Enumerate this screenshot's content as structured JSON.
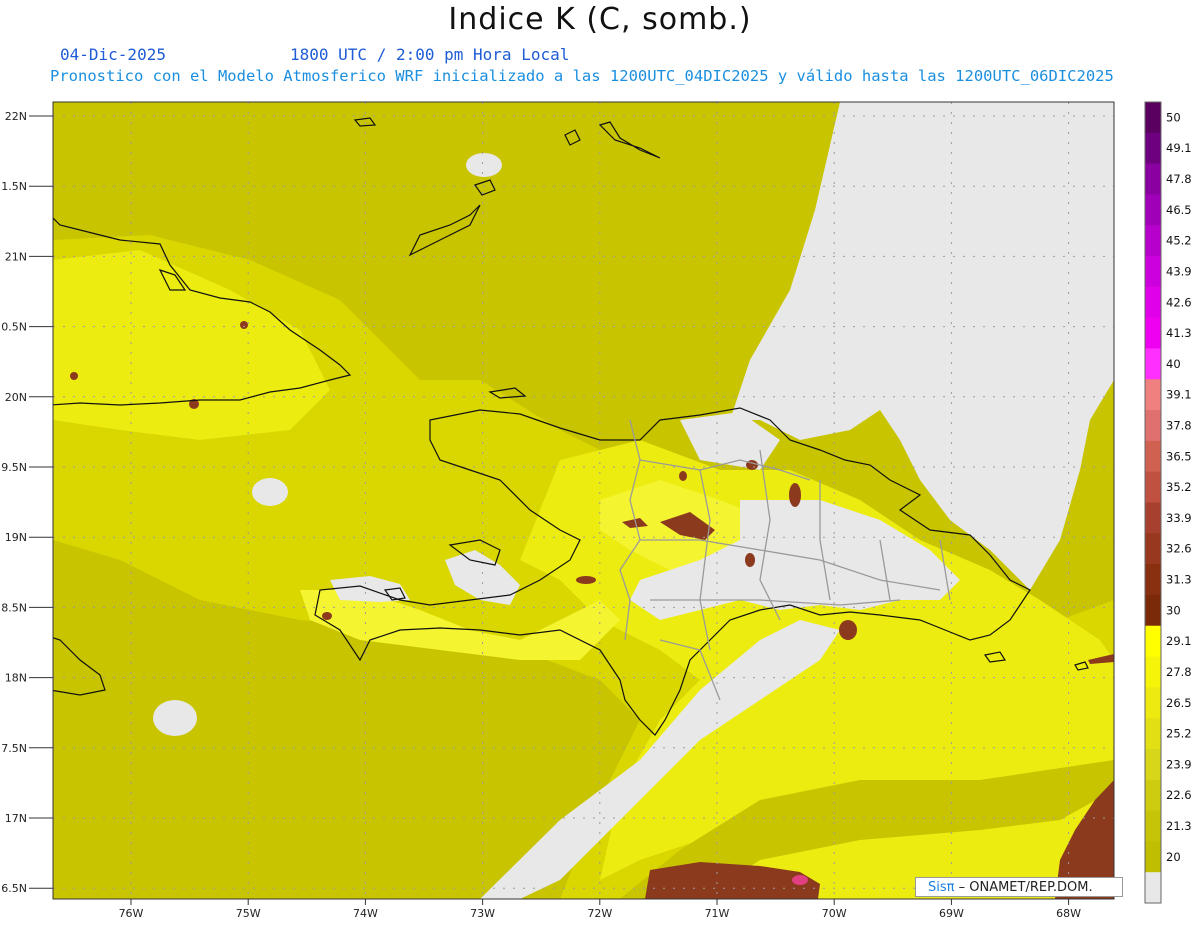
{
  "header": {
    "title": "Indice K (C, somb.)",
    "date": "04-Dic-2025",
    "time": "1800 UTC / 2:00 pm Hora Local",
    "description": "Pronostico con el Modelo Atmosferico WRF inicializado a las 1200UTC_04DIC2025 y válido hasta las  1200UTC_06DIC2025"
  },
  "map": {
    "lat_labels": [
      "22N",
      "1.5N",
      "21N",
      "0.5N",
      "20N",
      "9.5N",
      "19N",
      "8.5N",
      "18N",
      "7.5N",
      "17N",
      "6.5N"
    ],
    "lon_labels": [
      "76W",
      "75W",
      "74W",
      "73W",
      "72W",
      "71W",
      "70W",
      "69W",
      "68W"
    ],
    "colors": {
      "background": "#e8e8e8",
      "field_base": "#c8c400",
      "field_mid": "#d9d600",
      "field_high": "#ecec10",
      "field_peak": "#f4f430",
      "field_hot": "#8b3a1e",
      "coast": "#111111",
      "borders": "#9a9a9a"
    }
  },
  "colorbar": {
    "labels": [
      "50",
      "49.1",
      "47.8",
      "46.5",
      "45.2",
      "43.9",
      "42.6",
      "41.3",
      "40",
      "39.1",
      "37.8",
      "36.5",
      "35.2",
      "33.9",
      "32.6",
      "31.3",
      "30",
      "29.1",
      "27.8",
      "26.5",
      "25.2",
      "23.9",
      "22.6",
      "21.3",
      "20"
    ],
    "colors": [
      "#5a0060",
      "#6e0080",
      "#8a00a0",
      "#a000b8",
      "#b800cc",
      "#cc00dd",
      "#e000ea",
      "#f000f0",
      "#ff30ff",
      "#f08080",
      "#e07070",
      "#d06050",
      "#c05040",
      "#a84030",
      "#98381e",
      "#883010",
      "#7a2a08",
      "#ffff00",
      "#f6f408",
      "#ecea10",
      "#e2e014",
      "#d8d618",
      "#cecc10",
      "#c6c408",
      "#c0be00",
      "#e8e8e8"
    ]
  },
  "credit": {
    "sis": "Sisπ",
    "text": " – ONAMET/REP.DOM."
  }
}
